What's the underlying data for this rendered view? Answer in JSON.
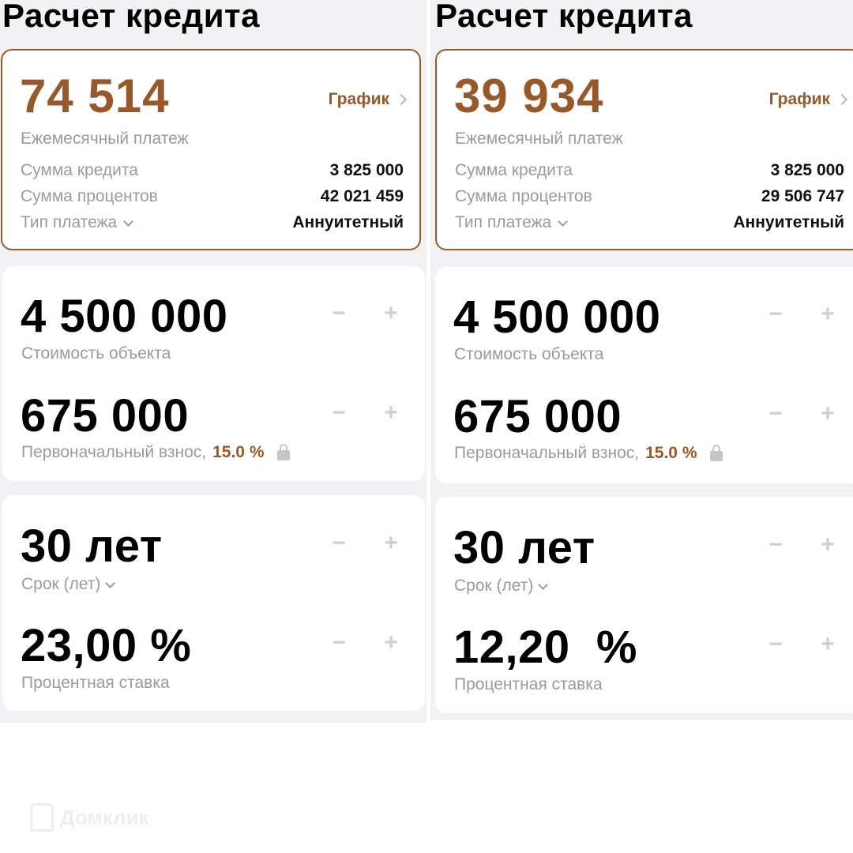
{
  "panels": [
    {
      "title": "Расчет кредита",
      "result": {
        "monthly_payment": "74 514",
        "monthly_payment_label": "Ежемесячный платеж",
        "schedule_label": "График",
        "loan_amount_label": "Сумма кредита",
        "loan_amount": "3 825 000",
        "interest_total_label": "Сумма процентов",
        "interest_total": "42 021 459",
        "payment_type_label": "Тип платежа",
        "payment_type": "Аннуитетный"
      },
      "object": {
        "price": "4 500 000",
        "price_label": "Стоимость объекта",
        "down_payment": "675 000",
        "down_payment_label": "Первоначальный взнос,",
        "down_payment_pct": "15.0 %"
      },
      "term": {
        "years": "30 лет",
        "years_label": "Срок (лет)",
        "rate": "23,00 %",
        "rate_label": "Процентная ставка"
      }
    },
    {
      "title": "Расчет кредита",
      "result": {
        "monthly_payment": "39 934",
        "monthly_payment_label": "Ежемесячный платеж",
        "schedule_label": "График",
        "loan_amount_label": "Сумма кредита",
        "loan_amount": "3 825 000",
        "interest_total_label": "Сумма процентов",
        "interest_total": "29 506 747",
        "payment_type_label": "Тип платежа",
        "payment_type": "Аннуитетный"
      },
      "object": {
        "price": "4 500 000",
        "price_label": "Стоимость объекта",
        "down_payment": "675 000",
        "down_payment_label": "Первоначальный взнос,",
        "down_payment_pct": "15.0 %"
      },
      "term": {
        "years": "30 лет",
        "years_label": "Срок (лет)",
        "rate": "12,20  %",
        "rate_label": "Процентная ставка"
      }
    }
  ],
  "stepper": {
    "minus": "−",
    "plus": "+"
  },
  "watermark": {
    "text": "Домклик",
    "icon": "domclick-logo-icon"
  },
  "colors": {
    "accent": "#98592a",
    "background": "#f2f2f5",
    "muted": "#9a9a9f"
  }
}
